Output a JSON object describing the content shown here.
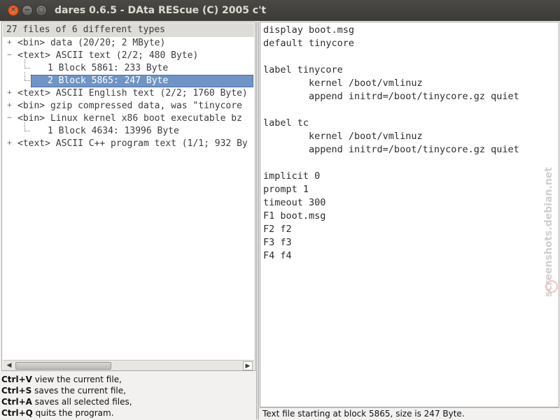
{
  "window": {
    "title": "dares 0.6.5 - DAta REScue (C) 2005 c't",
    "buttons": {
      "close": "✕",
      "minimize": "−",
      "maximize": "▢"
    }
  },
  "tree": {
    "header": "27 files of 6 different types",
    "rows": [
      {
        "expander": "+",
        "text": "<bin>  data (20/20; 2 MByte)"
      },
      {
        "expander": "−",
        "text": "<text> ASCII text (2/2; 480 Byte)"
      },
      {
        "text": "1 Block     5861:    233  Byte"
      },
      {
        "text": "2 Block     5865:    247  Byte",
        "selected": true
      },
      {
        "expander": "+",
        "text": "<text> ASCII English text (2/2; 1760 Byte)"
      },
      {
        "expander": "+",
        "text": "<bin>  gzip compressed data, was \"tinycore"
      },
      {
        "expander": "−",
        "text": "<bin>  Linux kernel x86 boot executable bz"
      },
      {
        "text": "1 Block     4634:  13996  Byte"
      },
      {
        "expander": "+",
        "text": "<text> ASCII C++ program text (1/1; 932 By"
      }
    ],
    "scroll": {
      "left_arrow": "◀",
      "right_arrow": "▶"
    }
  },
  "help": [
    {
      "key": "Ctrl+V",
      "text": " view the current file,"
    },
    {
      "key": "Ctrl+S",
      "text": " saves the current file,"
    },
    {
      "key": "Ctrl+A",
      "text": " saves all selected files,"
    },
    {
      "key": "Ctrl+Q",
      "text": " quits the program."
    }
  ],
  "file_content": "display boot.msg\ndefault tinycore\n\nlabel tinycore\n        kernel /boot/vmlinuz\n        append initrd=/boot/tinycore.gz quiet\n\nlabel tc\n        kernel /boot/vmlinuz\n        append initrd=/boot/tinycore.gz quiet\n\nimplicit 0\nprompt 1\ntimeout 300\nF1 boot.msg\nF2 f2\nF3 f3\nF4 f4",
  "status": "Text file starting at block 5865, size is 247 Byte.",
  "watermark": "screenshots.debian.net"
}
